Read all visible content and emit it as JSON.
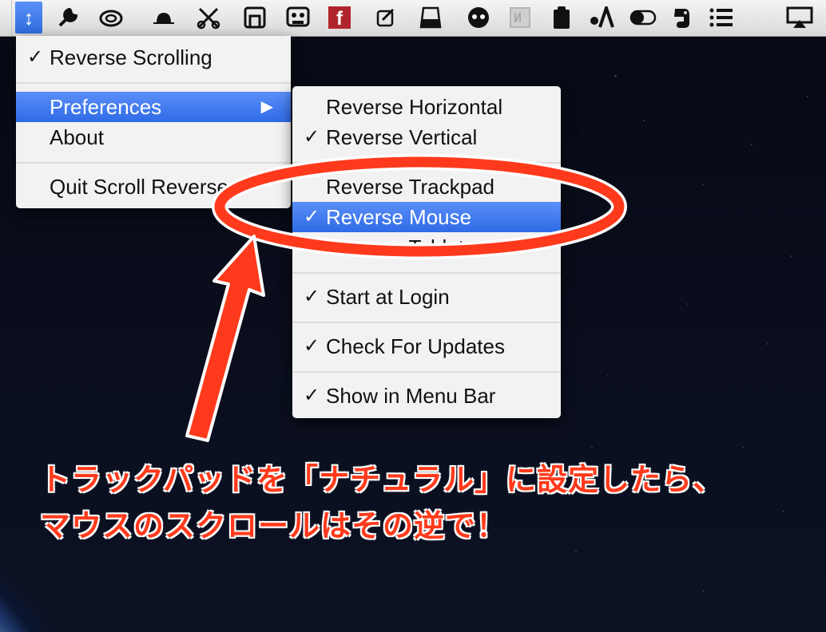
{
  "menubar": {
    "icons": [
      {
        "name": "scroll-reverser-icon",
        "glyph": "↕"
      },
      {
        "name": "tools-icon",
        "glyph": "🔧"
      },
      {
        "name": "creative-cloud-icon",
        "glyph": "∞"
      },
      {
        "name": "hat-icon",
        "glyph": "⌓"
      },
      {
        "name": "scissors-icon",
        "glyph": "✂"
      },
      {
        "name": "window-icon",
        "glyph": "⧉"
      },
      {
        "name": "cassette-icon",
        "glyph": "⌸"
      },
      {
        "name": "facebook-icon",
        "glyph": "f"
      },
      {
        "name": "edit-icon",
        "glyph": "✎"
      },
      {
        "name": "drawer-icon",
        "glyph": "⌷"
      },
      {
        "name": "cat-icon",
        "glyph": "●"
      },
      {
        "name": "typewriter-icon",
        "glyph": "▢"
      },
      {
        "name": "clipboard-icon",
        "glyph": "▮"
      },
      {
        "name": "alfred-icon",
        "glyph": "δ"
      },
      {
        "name": "toggle-icon",
        "glyph": "◐"
      },
      {
        "name": "evernote-icon",
        "glyph": "❦"
      },
      {
        "name": "list-icon",
        "glyph": "☰"
      },
      {
        "name": "airplay-icon",
        "glyph": "▭"
      }
    ]
  },
  "main_menu": {
    "items": [
      {
        "label": "Reverse Scrolling",
        "checked": true
      },
      {
        "label": "Preferences",
        "checked": false,
        "submenu": true
      },
      {
        "label": "About",
        "checked": false
      },
      {
        "label": "Quit Scroll Reverser",
        "checked": false
      }
    ],
    "check_glyph": "✓",
    "submenu_arrow": "▶"
  },
  "submenu": {
    "items": [
      {
        "label": "Reverse Horizontal",
        "checked": false
      },
      {
        "label": "Reverse Vertical",
        "checked": true
      },
      {
        "label": "Reverse Trackpad",
        "checked": false
      },
      {
        "label": "Reverse Mouse",
        "checked": true
      },
      {
        "label": "Reverse Tablet",
        "checked": true
      },
      {
        "label": "Start at Login",
        "checked": true
      },
      {
        "label": "Check For Updates",
        "checked": true
      },
      {
        "label": "Show in Menu Bar",
        "checked": true
      }
    ]
  },
  "annotation": {
    "line1": "トラックパッドを「ナチュラル」に設定したら、",
    "line2": "マウスのスクロールはその逆で！",
    "color": "#ff3a1c"
  },
  "colors": {
    "highlight": "#2e6be6",
    "annotation": "#ff3a1c"
  }
}
